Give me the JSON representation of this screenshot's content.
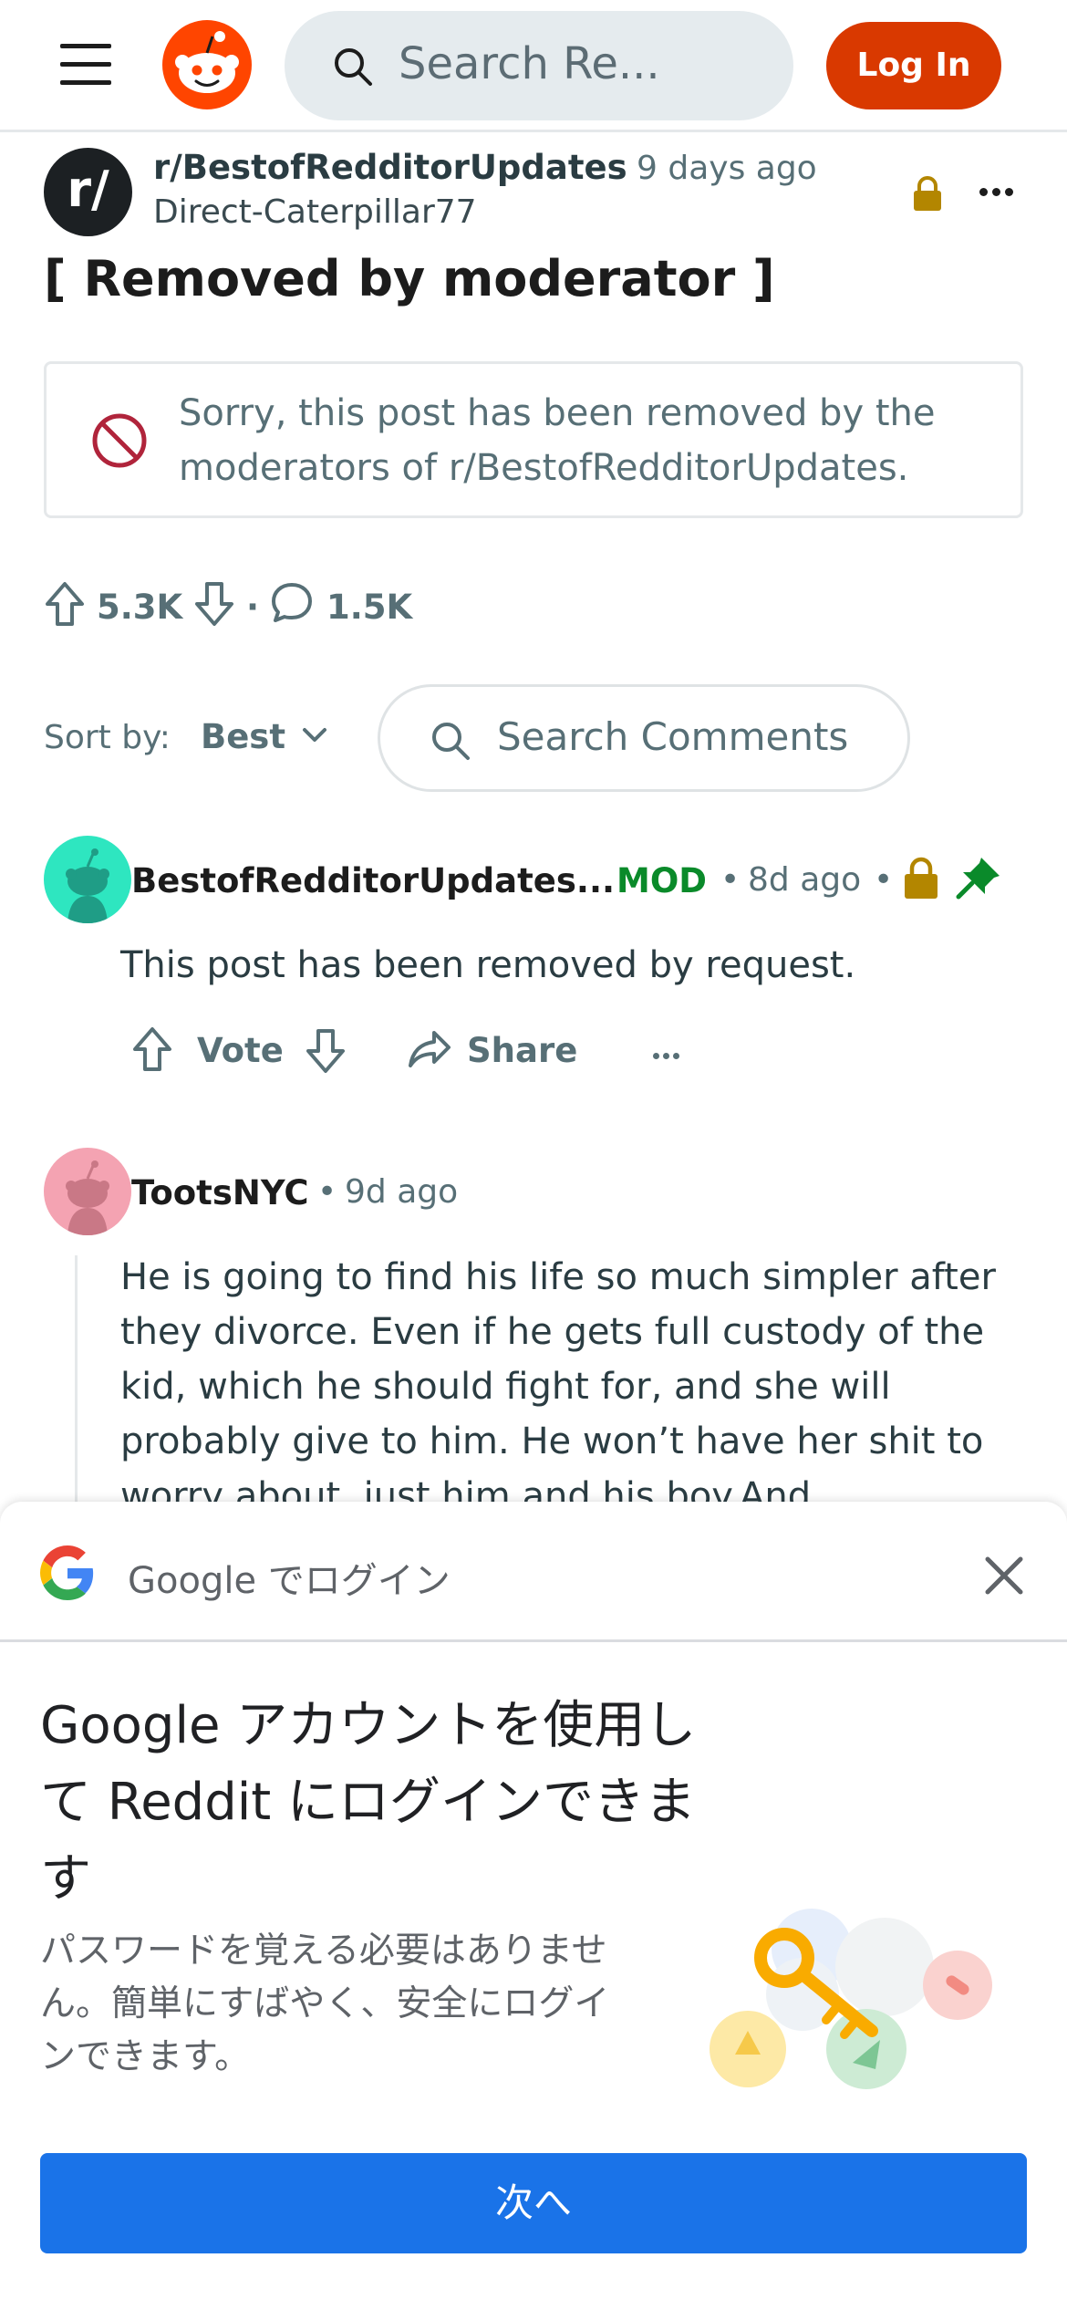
{
  "header": {
    "search_placeholder": "Search Re...",
    "login_label": "Log In"
  },
  "post": {
    "avatar_text": "r/",
    "subreddit": "r/BestofRedditorUpdates",
    "time": "9 days ago",
    "author": "Direct-Caterpillar77",
    "title": "[ Removed by moderator ]",
    "removed_message": "Sorry, this post has been removed by the moderators of r/BestofRedditorUpdates.",
    "upvotes": "5.3K",
    "separator": "·",
    "comments": "1.5K"
  },
  "sort": {
    "label": "Sort by:",
    "value": "Best",
    "search_placeholder": "Search Comments"
  },
  "comments": [
    {
      "author": "BestofRedditorUpdates...",
      "badge": "MOD",
      "sep1": "•",
      "time": "8d ago",
      "sep2": "•",
      "body": "This post has been removed by request.",
      "vote_label": "Vote",
      "share_label": "Share",
      "avatar_color": "#2ee6c0"
    },
    {
      "author": "TootsNYC",
      "sep1": "•",
      "time": "9d ago",
      "body": "He is going to find his life so much simpler after they divorce. Even if he gets full custody of the kid, which he should fight for, and she will probably give to him. He won’t have her shit to worry about, just him and his boy.And",
      "avatar_color": "#f4a3b2"
    }
  ],
  "google_login": {
    "header": "Google でログイン",
    "title": "Google アカウントを使用して Reddit にログインできます",
    "description": "パスワードを覚える必要はありません。簡単にすばやく、安全にログインできます。",
    "next_label": "次へ"
  },
  "colors": {
    "reddit_orange": "#ff4500",
    "login_button": "#d93900",
    "mod_green": "#0a8a2a",
    "lock_gold": "#b38600",
    "google_blue": "#1a73e8"
  },
  "icons": [
    "menu-icon",
    "reddit-logo",
    "search-icon",
    "lock-icon",
    "more-icon",
    "ban-icon",
    "upvote-icon",
    "downvote-icon",
    "comment-icon",
    "chevron-down-icon",
    "pin-icon",
    "share-icon",
    "google-logo",
    "close-icon",
    "key-illustration"
  ]
}
